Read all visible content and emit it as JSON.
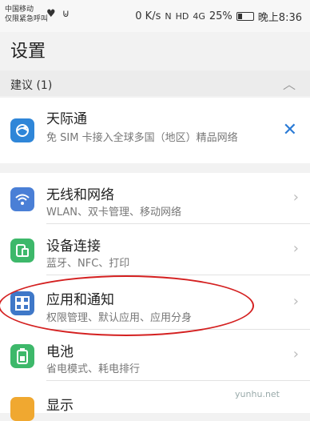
{
  "status": {
    "carrier_line1": "中国移动",
    "carrier_line2": "仅限紧急呼叫",
    "left_icons": "♥ ⊍",
    "speed": "0 K/s",
    "nfc": "N",
    "hd": "HD",
    "network": "4G",
    "battery_pct": "25%",
    "time": "晚上8:36"
  },
  "page_title": "设置",
  "suggestions": {
    "label": "建议 (1)",
    "item": {
      "title": "天际通",
      "desc": "免 SIM 卡接入全球多国（地区）精品网络"
    }
  },
  "menu": [
    {
      "title": "无线和网络",
      "sub": "WLAN、双卡管理、移动网络",
      "icon": "wifi-icon",
      "color": "#4a7fd6"
    },
    {
      "title": "设备连接",
      "sub": "蓝牙、NFC、打印",
      "icon": "device-connect-icon",
      "color": "#3db86a"
    },
    {
      "title": "应用和通知",
      "sub": "权限管理、默认应用、应用分身",
      "icon": "apps-grid-icon",
      "color": "#3f78c8"
    },
    {
      "title": "电池",
      "sub": "省电模式、耗电排行",
      "icon": "battery-icon",
      "color": "#3db86a"
    },
    {
      "title": "显示",
      "sub": "",
      "icon": "display-icon",
      "color": "#f0a830"
    }
  ],
  "watermark": "yunhu.net"
}
